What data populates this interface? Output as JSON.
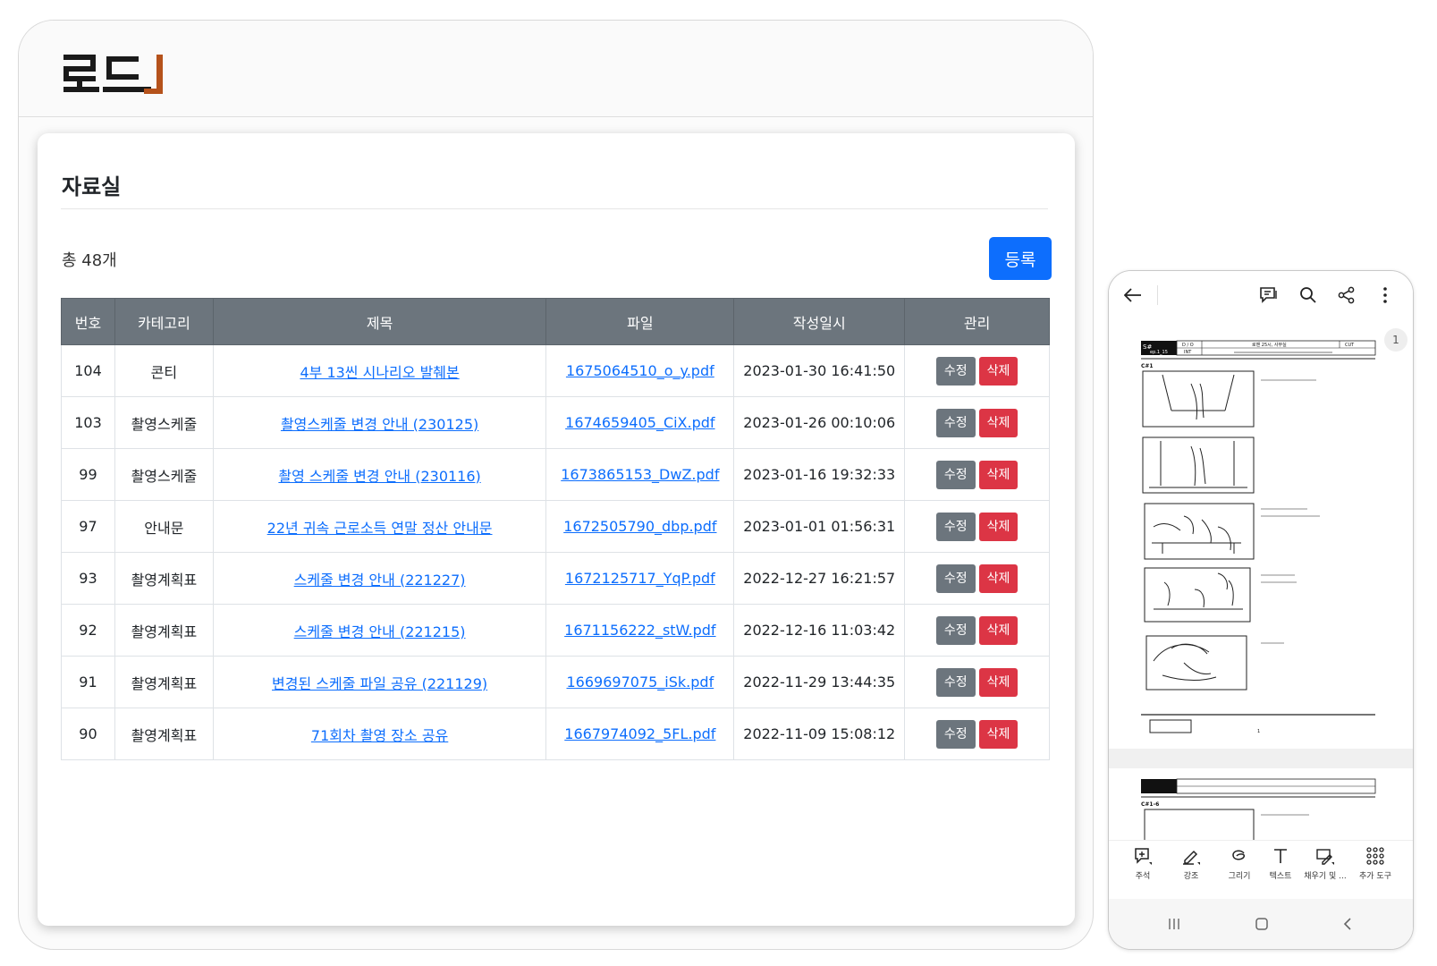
{
  "brand": {
    "logo_text": "로드"
  },
  "page": {
    "title": "자료실",
    "total": "총 48개",
    "register_label": "등록"
  },
  "table": {
    "headers": [
      "번호",
      "카테고리",
      "제목",
      "파일",
      "작성일시",
      "관리"
    ],
    "edit_label": "수정",
    "delete_label": "삭제",
    "rows": [
      {
        "no": "104",
        "category": "콘티",
        "title": "4부 13씬 시나리오 발췌본",
        "file": "1675064510_o_y.pdf",
        "date": "2023-01-30 16:41:50"
      },
      {
        "no": "103",
        "category": "촬영스케줄",
        "title": "촬영스케줄 변경 안내 (230125)",
        "file": "1674659405_CiX.pdf",
        "date": "2023-01-26 00:10:06"
      },
      {
        "no": "99",
        "category": "촬영스케줄",
        "title": "촬영 스케줄 변경 안내 (230116)",
        "file": "1673865153_DwZ.pdf",
        "date": "2023-01-16 19:32:33"
      },
      {
        "no": "97",
        "category": "안내문",
        "title": "22년 귀속 근로소득 연말 정산 안내문",
        "file": "1672505790_dbp.pdf",
        "date": "2023-01-01 01:56:31"
      },
      {
        "no": "93",
        "category": "촬영계획표",
        "title": "스케줄 변경 안내 (221227)",
        "file": "1672125717_YqP.pdf",
        "date": "2022-12-27 16:21:57"
      },
      {
        "no": "92",
        "category": "촬영계획표",
        "title": "스케줄 변경 안내 (221215)",
        "file": "1671156222_stW.pdf",
        "date": "2022-12-16 11:03:42"
      },
      {
        "no": "91",
        "category": "촬영계획표",
        "title": "변경된 스케줄 파일 공유 (221129)",
        "file": "1669697075_iSk.pdf",
        "date": "2022-11-29 13:44:35"
      },
      {
        "no": "90",
        "category": "촬영계획표",
        "title": "71회차 촬영 장소 공유",
        "file": "1667974092_5FL.pdf",
        "date": "2022-11-09 15:08:12"
      }
    ]
  },
  "mobile": {
    "page_indicator": "1",
    "pdf": {
      "scene_tag": "S#",
      "episode": "ep.1_15",
      "do_label": "D / O",
      "int_label": "INT",
      "location": "로맨 25시, 사무실",
      "cut_label": "CUT",
      "cut1": "C#1",
      "cut2": "C#1-6",
      "footer_page": "1"
    },
    "tools": [
      {
        "icon": "comment-add-icon",
        "label": "주석"
      },
      {
        "icon": "highlight-pen-icon",
        "label": "강조"
      },
      {
        "icon": "draw-icon",
        "label": "그리기"
      },
      {
        "icon": "text-icon",
        "label": "텍스트"
      },
      {
        "icon": "fill-sign-icon",
        "label": "채우기 및 ..."
      },
      {
        "icon": "more-tools-icon",
        "label": "추가 도구"
      }
    ]
  },
  "colors": {
    "primary": "#0d6efd",
    "danger": "#dc3545",
    "secondary": "#6c757d",
    "logo_accent": "#b5521b"
  }
}
